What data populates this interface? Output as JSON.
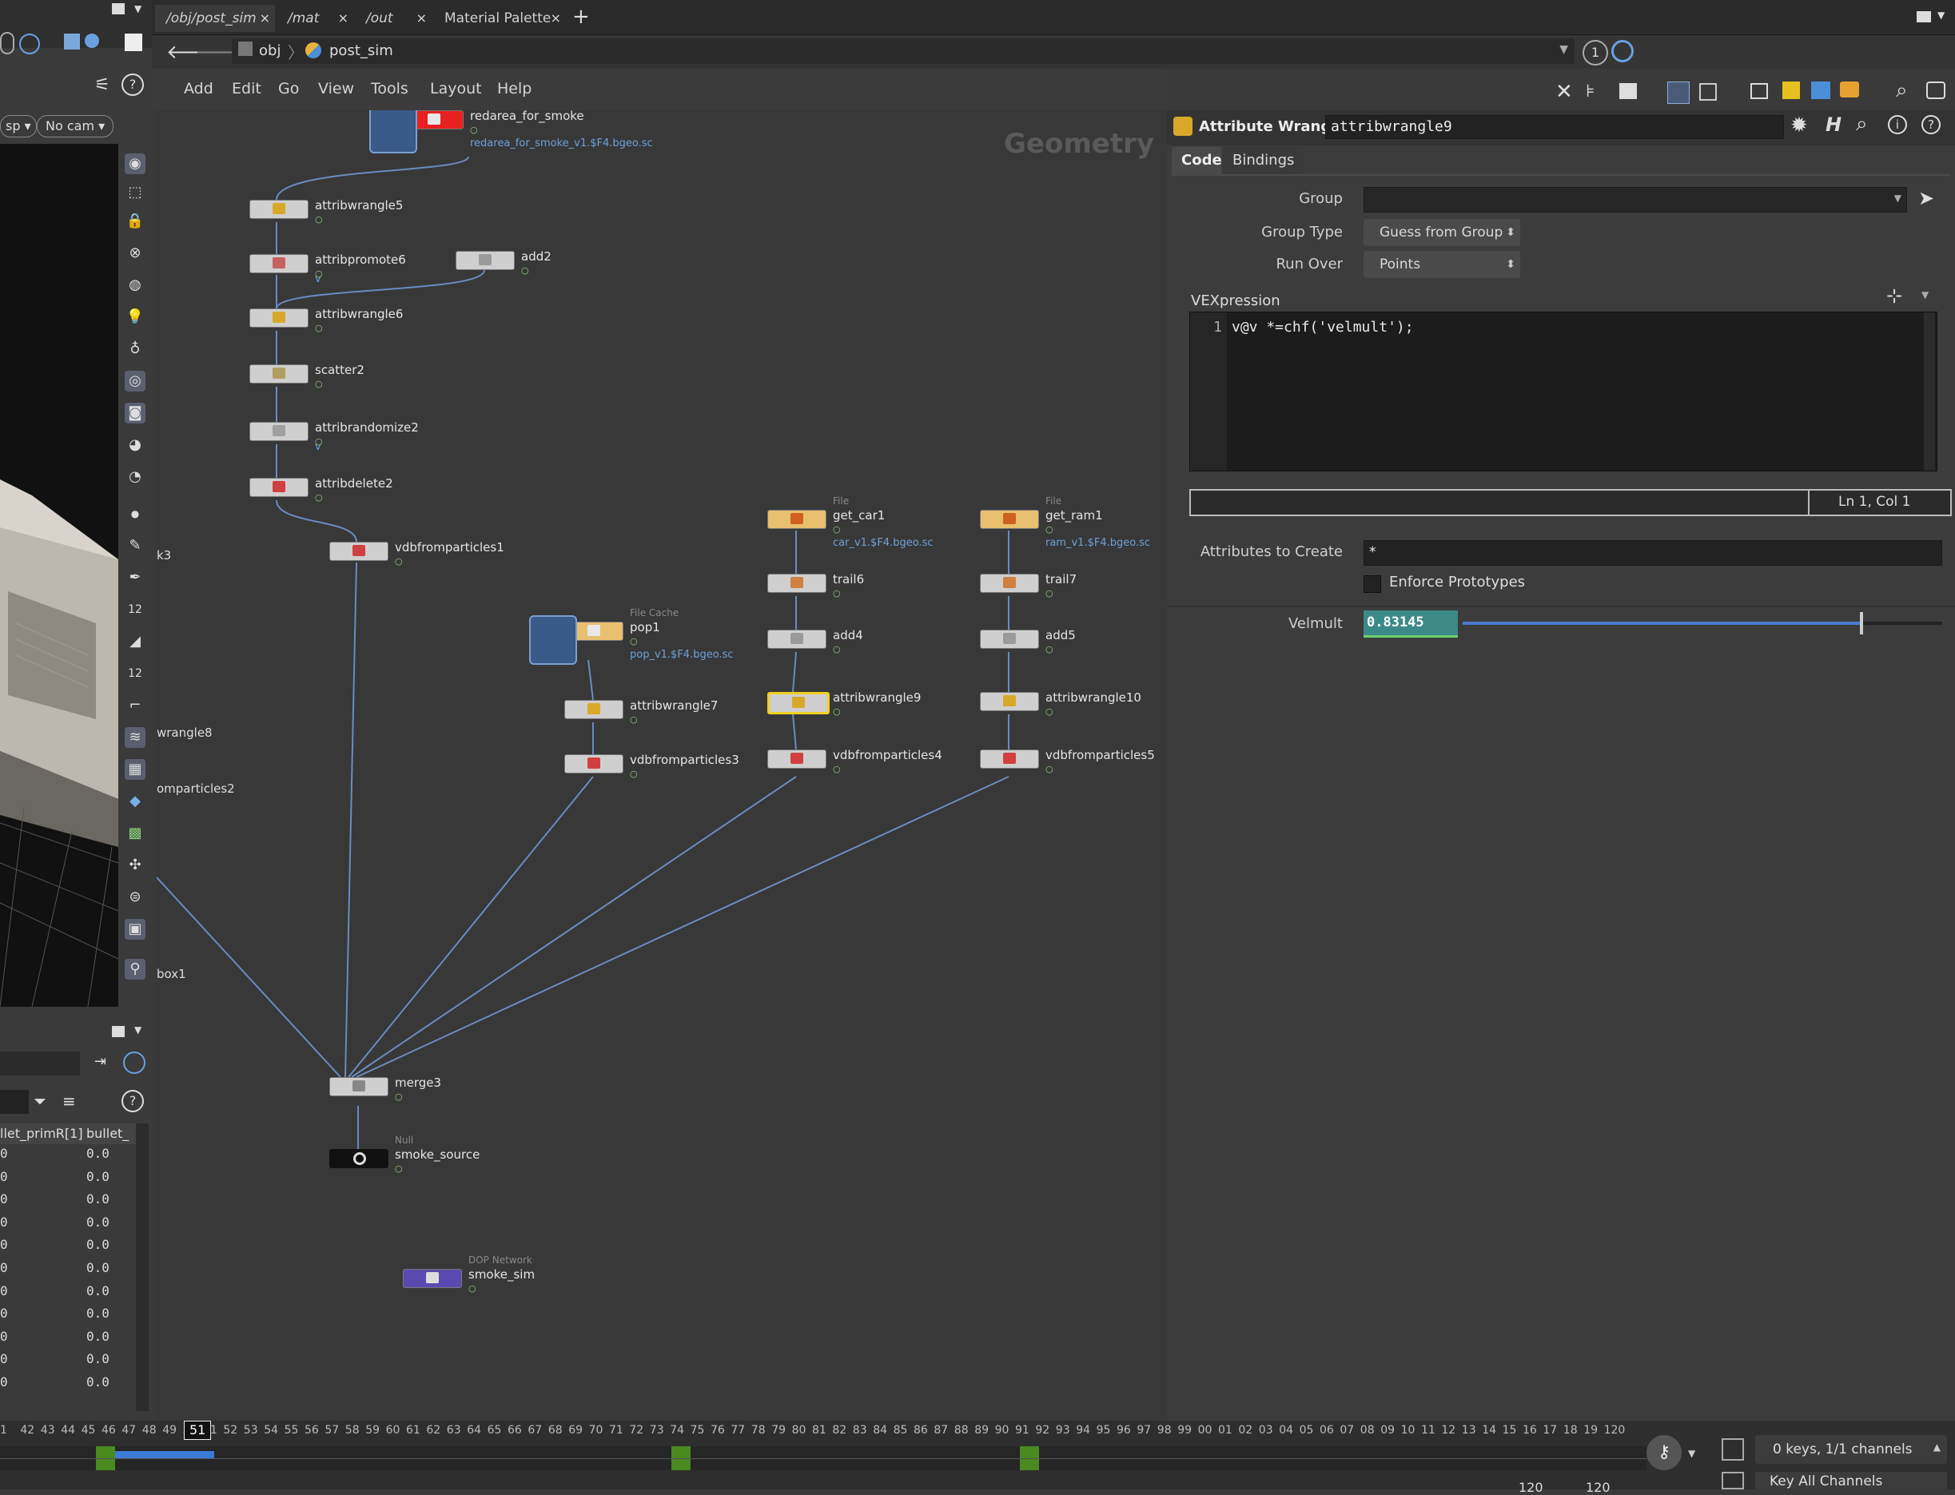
{
  "tabs": [
    {
      "label": "/obj/post_sim"
    },
    {
      "label": "/mat"
    },
    {
      "label": "/out"
    },
    {
      "label": "Material Palette"
    }
  ],
  "path": {
    "root": "obj",
    "current": "post_sim",
    "badge": "1"
  },
  "menu": [
    "Add",
    "Edit",
    "Go",
    "View",
    "Tools",
    "Layout",
    "Help"
  ],
  "viewport": {
    "persp": "sp",
    "camera": "No cam"
  },
  "network": {
    "context_label": "Geometry",
    "nodes": [
      {
        "id": "redarea_for_smoke",
        "label": "redarea_for_smoke",
        "type": "File Cache",
        "file": "redarea_for_smoke_v1.$F4.bgeo.sc"
      },
      {
        "id": "attribwrangle5",
        "label": "attribwrangle5"
      },
      {
        "id": "attribpromote6",
        "label": "attribpromote6",
        "sub": "v"
      },
      {
        "id": "add2",
        "label": "add2"
      },
      {
        "id": "attribwrangle6",
        "label": "attribwrangle6"
      },
      {
        "id": "scatter2",
        "label": "scatter2"
      },
      {
        "id": "attribrandomize2",
        "label": "attribrandomize2",
        "sub": "v"
      },
      {
        "id": "attribdelete2",
        "label": "attribdelete2"
      },
      {
        "id": "vdbfromparticles1",
        "label": "vdbfromparticles1"
      },
      {
        "id": "pop1",
        "label": "pop1",
        "type": "File Cache",
        "file": "pop_v1.$F4.bgeo.sc"
      },
      {
        "id": "attribwrangle7",
        "label": "attribwrangle7"
      },
      {
        "id": "vdbfromparticles3",
        "label": "vdbfromparticles3"
      },
      {
        "id": "get_car1",
        "label": "get_car1",
        "type": "File",
        "file": "car_v1.$F4.bgeo.sc"
      },
      {
        "id": "trail6",
        "label": "trail6"
      },
      {
        "id": "add4",
        "label": "add4"
      },
      {
        "id": "attribwrangle9",
        "label": "attribwrangle9"
      },
      {
        "id": "vdbfromparticles4",
        "label": "vdbfromparticles4"
      },
      {
        "id": "get_ram1",
        "label": "get_ram1",
        "type": "File",
        "file": "ram_v1.$F4.bgeo.sc"
      },
      {
        "id": "trail7",
        "label": "trail7"
      },
      {
        "id": "add5",
        "label": "add5"
      },
      {
        "id": "attribwrangle10",
        "label": "attribwrangle10"
      },
      {
        "id": "vdbfromparticles5",
        "label": "vdbfromparticles5"
      },
      {
        "id": "merge3",
        "label": "merge3"
      },
      {
        "id": "smoke_source",
        "label": "smoke_source",
        "type": "Null"
      },
      {
        "id": "smoke_sim",
        "label": "smoke_sim",
        "type": "DOP Network"
      }
    ],
    "offscreen_labels": [
      "k3",
      "wrangle8",
      "omparticles2",
      "box1"
    ]
  },
  "params": {
    "node_type": "Attribute Wrangle",
    "node_name": "attribwrangle9",
    "tabs": [
      "Code",
      "Bindings"
    ],
    "group_label": "Group",
    "group_value": "",
    "group_type_label": "Group Type",
    "group_type_value": "Guess from Group",
    "run_over_label": "Run Over",
    "run_over_value": "Points",
    "vex_label": "VEXpression",
    "code_line_no": "1",
    "code": "v@v *=chf('velmult');",
    "cursor_pos": "Ln 1, Col 1",
    "attrs_label": "Attributes to Create",
    "attrs_value": "*",
    "enforce_label": "Enforce Prototypes",
    "velmult_label": "Velmult",
    "velmult_value": "0.83145",
    "velmult_fraction": 0.83145
  },
  "spreadsheet": {
    "headers": [
      "llet_primR[1]",
      "bullet_"
    ],
    "rows": [
      "0.0",
      "0.0",
      "0.0",
      "0.0",
      "0.0",
      "0.0",
      "0.0",
      "0.0",
      "0.0",
      "0.0",
      "0.0"
    ]
  },
  "timeline": {
    "ticks": [
      "1",
      "42",
      "43",
      "44",
      "45",
      "46",
      "47",
      "48",
      "49",
      "50",
      "51",
      "52",
      "53",
      "54",
      "55",
      "56",
      "57",
      "58",
      "59",
      "60",
      "61",
      "62",
      "63",
      "64",
      "65",
      "66",
      "67",
      "68",
      "69",
      "70",
      "71",
      "72",
      "73",
      "74",
      "75",
      "76",
      "77",
      "78",
      "79",
      "80",
      "81",
      "82",
      "83",
      "84",
      "85",
      "86",
      "87",
      "88",
      "89",
      "90",
      "91",
      "92",
      "93",
      "94",
      "95",
      "96",
      "97",
      "98",
      "99",
      "00",
      "01",
      "02",
      "03",
      "04",
      "05",
      "06",
      "07",
      "08",
      "09",
      "10",
      "11",
      "12",
      "13",
      "14",
      "15",
      "16",
      "17",
      "18",
      "19",
      "120"
    ],
    "current_frame": "51",
    "keys_status": "0 keys, 1/1 channels",
    "key_all": "Key All Channels",
    "start": "120",
    "end": "120"
  }
}
